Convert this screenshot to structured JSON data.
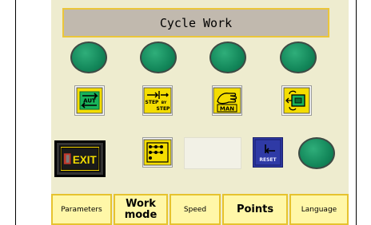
{
  "header": {
    "title": "Cycle Work"
  },
  "buttons": {
    "auto": {
      "label": "AUT",
      "icon": "auto-cycle-icon"
    },
    "step": {
      "label_top": "STEP",
      "label_mid": "BY",
      "label_bottom": "STEP",
      "icon": "step-by-step-icon"
    },
    "manual": {
      "label": "MAN",
      "icon": "manual-hand-icon"
    },
    "machine": {
      "icon": "machine-cycle-icon"
    },
    "exit": {
      "label": "EXIT",
      "icon": "exit-door-icon"
    },
    "grid": {
      "icon": "grid-matrix-icon"
    },
    "reset": {
      "label": "RESET",
      "icon": "reset-arrow-icon"
    }
  },
  "indicator_lamps": {
    "count": 5,
    "color": "#13875a"
  },
  "tabs": [
    {
      "label": "Parameters"
    },
    {
      "label": "Work mode"
    },
    {
      "label": "Speed"
    },
    {
      "label": "Points"
    },
    {
      "label": "Language"
    }
  ],
  "colors": {
    "panel_bg": "#eeeccf",
    "title_bg": "#c1b9ae",
    "accent_yellow": "#ebc63a",
    "tab_bg": "#fff7a8",
    "lamp_green": "#13875a",
    "reset_blue": "#2f3aa6",
    "auto_green": "#18b35a"
  }
}
